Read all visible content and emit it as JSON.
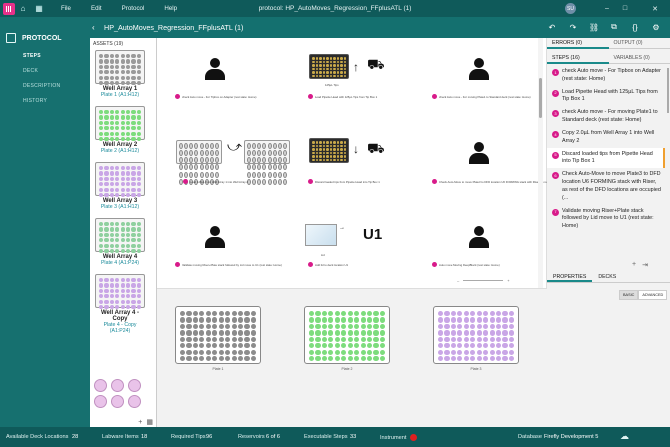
{
  "app": {
    "window_title": "protocol: HP_AutoMoves_Regression_FFplusATL (1)",
    "menu": [
      "File",
      "Edit",
      "Protocol",
      "Help"
    ],
    "user_initials": "SU",
    "accent": "#0f5a5a"
  },
  "leftnav": {
    "heading": "PROTOCOL",
    "items": [
      "STEPS",
      "DECK",
      "DESCRIPTION",
      "HISTORY"
    ]
  },
  "titlebar": {
    "name": "HP_AutoMoves_Regression_FFplusATL (1)"
  },
  "assets": {
    "header": "ASSETS (19)",
    "items": [
      {
        "name": "Well Array 1",
        "sub": "Plate 1 (A1:H12)",
        "color": "#9a9a9a"
      },
      {
        "name": "Well Array 2",
        "sub": "Plate 2 (A1:H12)",
        "color": "#7ddc7d"
      },
      {
        "name": "Well Array 3",
        "sub": "Plate 3 (A1:H12)",
        "color": "#c9a6e6"
      },
      {
        "name": "Well Array 4",
        "sub": "Plate 4 (A1:P24)",
        "color": "#8fd09f"
      },
      {
        "name": "Well Array 4 - Copy",
        "sub": "Plate 4 - Copy (A1:P24)",
        "color": "#c9a6e6"
      }
    ]
  },
  "canvas": {
    "steps": [
      "check Auto move - For Tipbox on Adapter (rest state: Home)",
      "Load Pipette Head with 125µL Tips from Tip Box 1",
      "check Auto move - For moving Plate1 to Standard deck (rest state: Home)",
      "Load 125µL from Well Array 1 into Well Array 2",
      "Discard loaded tips from Pipette Head into Tip Box 1",
      "Check Auto-Move to move Plate3 to DFD location U6 FORMING stack with Riser, as rest of the DFD locations are occupied (rest state: Home)",
      "Validate moving Riser+Plate stack followed by Lid move to U1 (rest state: Home)",
      "Add lid to deck location U1",
      "Auto move Moving DeepBlock (rest state: Home)"
    ],
    "tip_label": "125µL Tips",
    "lid_label": "U1",
    "lid_sub": "Lid",
    "plates": [
      {
        "title": "Plate 1",
        "color": "#8c8c8c"
      },
      {
        "title": "Plate 2",
        "color": "#7ddc7d"
      },
      {
        "title": "Plate 3",
        "color": "#c9a6e6"
      }
    ]
  },
  "right": {
    "tabs_top": [
      "ERRORS (0)",
      "OUTPUT (0)"
    ],
    "tabs_mid": [
      "STEPS (16)",
      "VARIABLES (0)"
    ],
    "steps": [
      {
        "n": "1",
        "text": "check Auto move - For Tipbox on Adapter (rest state: Home)"
      },
      {
        "n": "2",
        "text": "Load Pipette Head with 125µL Tips from Tip Box 1"
      },
      {
        "n": "3",
        "text": "check Auto move - For moving Plate1 to Standard deck (rest state: Home)"
      },
      {
        "n": "4",
        "text": "Copy 2.0µL from Well Array 1 into Well Array 2"
      },
      {
        "n": "5",
        "text": "Discard loaded tips from Pipette Head into Tip Box 1"
      },
      {
        "n": "6",
        "text": "Check Auto-Move to move Plate3 to DFD location U6 FORMING stack with Riser, as rest of the DFD locations are occupied (..."
      },
      {
        "n": "7",
        "text": "Validate moving Riser+Plate stack followed by Lid move to U1 (rest state: Home)"
      }
    ],
    "props_tabs": [
      "PROPERTIES",
      "DECKS"
    ],
    "mode": [
      "BASIC",
      "ADVANCED"
    ]
  },
  "status": {
    "deck_label": "Available Deck Locations",
    "deck_val": "28",
    "labware_label": "Labware Items",
    "labware_val": "18",
    "tips_label": "Required Tips",
    "tips_val": "96",
    "res_label": "Reservoirs",
    "res_val": "6 of 6",
    "exec_label": "Executable Steps",
    "exec_val": "33",
    "instr_label": "Instrument",
    "db_label": "Database",
    "db_val": "Firefly Development 5"
  }
}
